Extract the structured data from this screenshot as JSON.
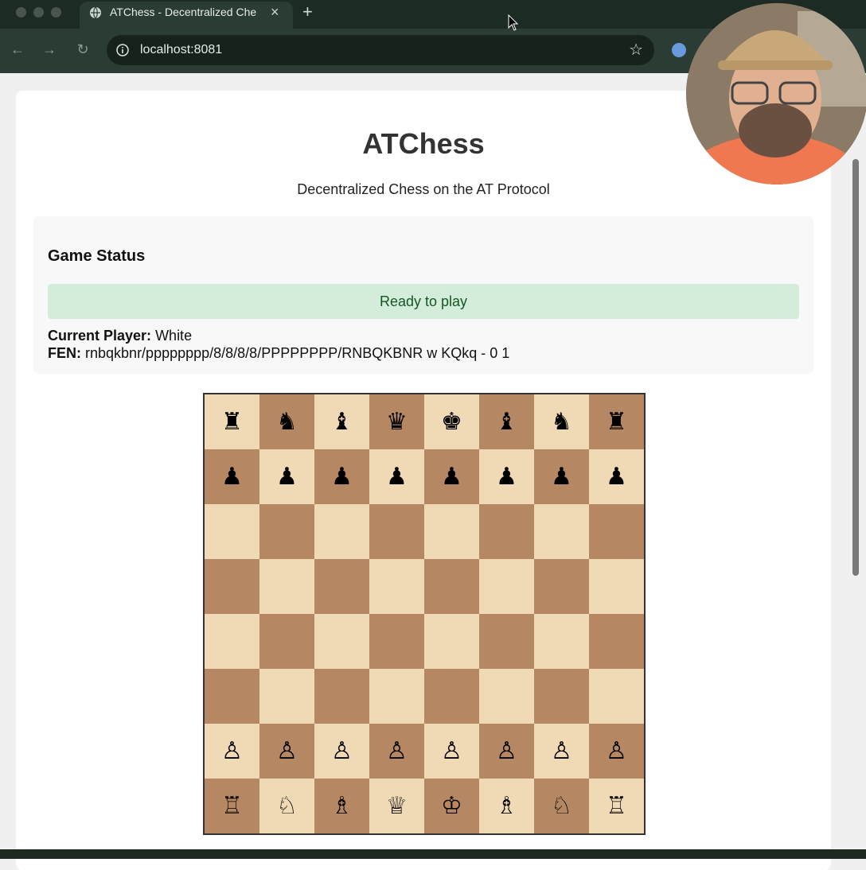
{
  "browser": {
    "tab_title": "ATChess - Decentralized Che",
    "url": "localhost:8081",
    "new_tab_symbol": "+",
    "close_symbol": "×"
  },
  "app": {
    "title": "ATChess",
    "subtitle": "Decentralized Chess on the AT Protocol"
  },
  "status": {
    "heading": "Game Status",
    "message": "Ready to play",
    "current_player_label": "Current Player:",
    "current_player_value": "White",
    "fen_label": "FEN:",
    "fen_value": "rnbqkbnr/pppppppp/8/8/8/8/PPPPPPPP/RNBQKBNR w KQkq - 0 1"
  },
  "board": {
    "rows": [
      [
        "♜",
        "♞",
        "♝",
        "♛",
        "♚",
        "♝",
        "♞",
        "♜"
      ],
      [
        "♟",
        "♟",
        "♟",
        "♟",
        "♟",
        "♟",
        "♟",
        "♟"
      ],
      [
        "",
        "",
        "",
        "",
        "",
        "",
        "",
        ""
      ],
      [
        "",
        "",
        "",
        "",
        "",
        "",
        "",
        ""
      ],
      [
        "",
        "",
        "",
        "",
        "",
        "",
        "",
        ""
      ],
      [
        "",
        "",
        "",
        "",
        "",
        "",
        "",
        ""
      ],
      [
        "♙",
        "♙",
        "♙",
        "♙",
        "♙",
        "♙",
        "♙",
        "♙"
      ],
      [
        "♖",
        "♘",
        "♗",
        "♕",
        "♔",
        "♗",
        "♘",
        "♖"
      ]
    ],
    "colors": {
      "light": "#f0d9b5",
      "dark": "#b58863"
    }
  },
  "colors": {
    "success_bg": "#d4edda",
    "success_text": "#155724",
    "chrome_bg": "#1c2b24"
  }
}
